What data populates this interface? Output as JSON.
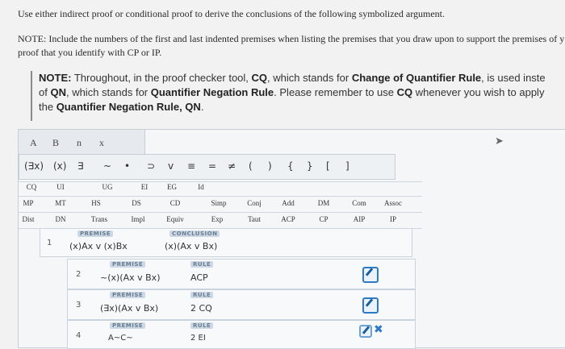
{
  "instructions": {
    "line1": "Use either indirect proof or conditional proof to derive the conclusions of the following symbolized argument.",
    "line2": "NOTE: Include the numbers of the first and last indented premises when listing the premises that you draw upon to support the premises of y",
    "line3": "proof that you identify with CP or IP."
  },
  "note": {
    "prefix": "NOTE:",
    "part1": " Throughout, in the proof checker tool, ",
    "cq": "CQ",
    "part2": ", which stands for ",
    "cqr": "Change of Quantifier Rule",
    "part3": ", is used inste",
    "part4": "of ",
    "qn": "QN",
    "part5": ", which stands for ",
    "qnr": "Quantifier Negation Rule",
    "part6": ". Please remember to use ",
    "cq2": "CQ",
    "part7": " whenever you wish to apply",
    "part8": "the ",
    "qnr2": "Quantifier Negation Rule, QN",
    "part9": "."
  },
  "tabs": [
    "A",
    "B",
    "n",
    "x"
  ],
  "symbols": [
    "(∃x)",
    "(x)",
    "∃",
    "~",
    "•",
    "⊃",
    "v",
    "≡",
    "=",
    "≠",
    "(",
    ")",
    "{",
    "}",
    "[",
    "]"
  ],
  "rules": {
    "row1": [
      "CQ",
      "UI",
      "UG",
      "EI",
      "EG",
      "Id"
    ],
    "row2": [
      "MP",
      "MT",
      "HS",
      "DS",
      "CD",
      "Simp",
      "Conj",
      "Add",
      "DM",
      "Com",
      "Assoc"
    ],
    "row3": [
      "Dist",
      "DN",
      "Trans",
      "Impl",
      "Equiv",
      "Exp",
      "Taut",
      "ACP",
      "CP",
      "AIP",
      "IP"
    ]
  },
  "labels": {
    "premise": "PREMISE",
    "conclusion": "CONCLUSION",
    "rule": "RULE"
  },
  "argument": {
    "num": "1",
    "premise": "(x)Ax v (x)Bx",
    "conclusion": "(x)(Ax v Bx)"
  },
  "lines": [
    {
      "num": "2",
      "formula": "~(x)(Ax v Bx)",
      "rule": "ACP"
    },
    {
      "num": "3",
      "formula": "(∃x)(Ax v Bx)",
      "rule": "2 CQ"
    },
    {
      "num": "4",
      "formula": "A~C~",
      "rule": "2 EI"
    }
  ]
}
